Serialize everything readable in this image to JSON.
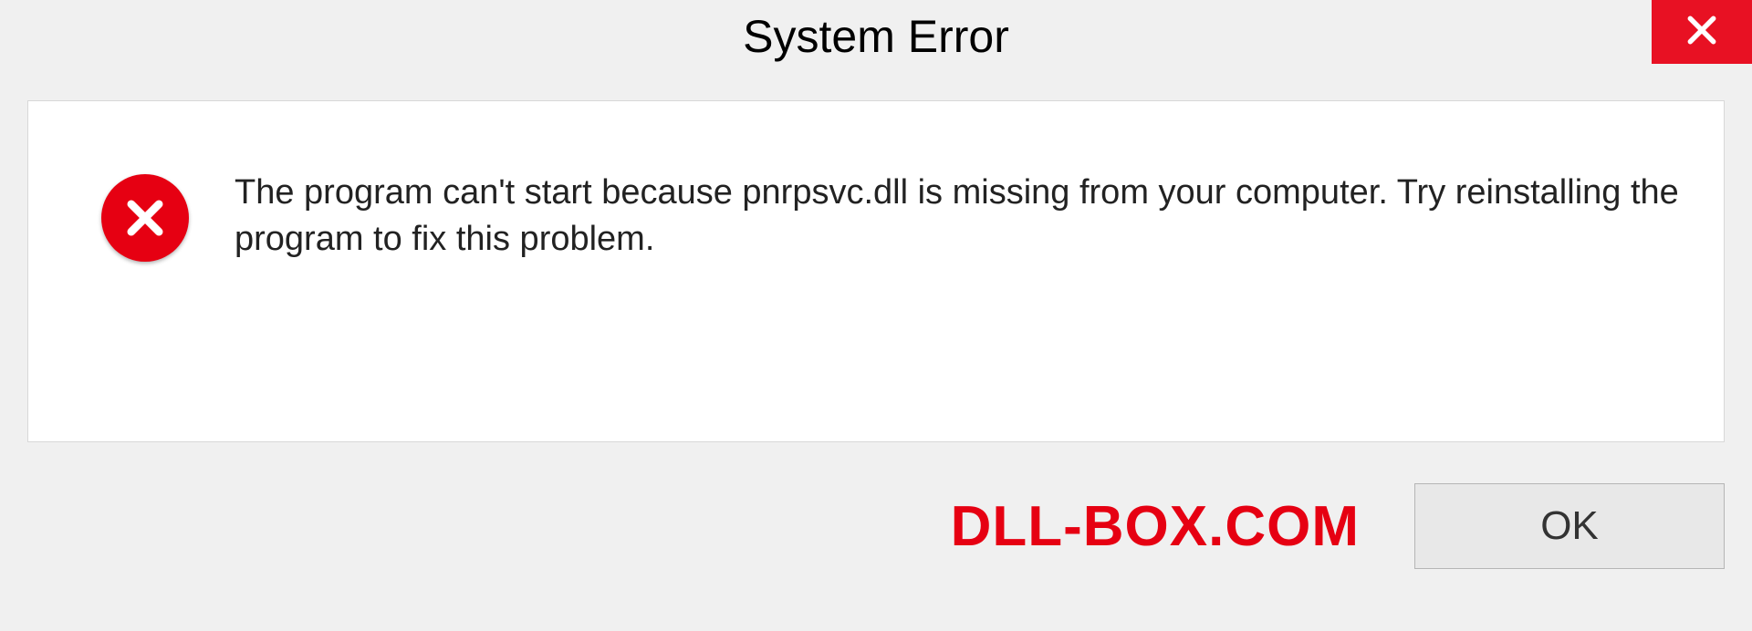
{
  "dialog": {
    "title": "System Error",
    "message": "The program can't start because pnrpsvc.dll is missing from your computer. Try reinstalling the program to fix this problem.",
    "ok_label": "OK"
  },
  "watermark": "DLL-BOX.COM",
  "icons": {
    "close": "close-icon",
    "error": "error-icon"
  },
  "colors": {
    "accent_red": "#e60012",
    "close_red": "#e81123",
    "panel_bg": "#ffffff",
    "dialog_bg": "#f0f0f0"
  }
}
